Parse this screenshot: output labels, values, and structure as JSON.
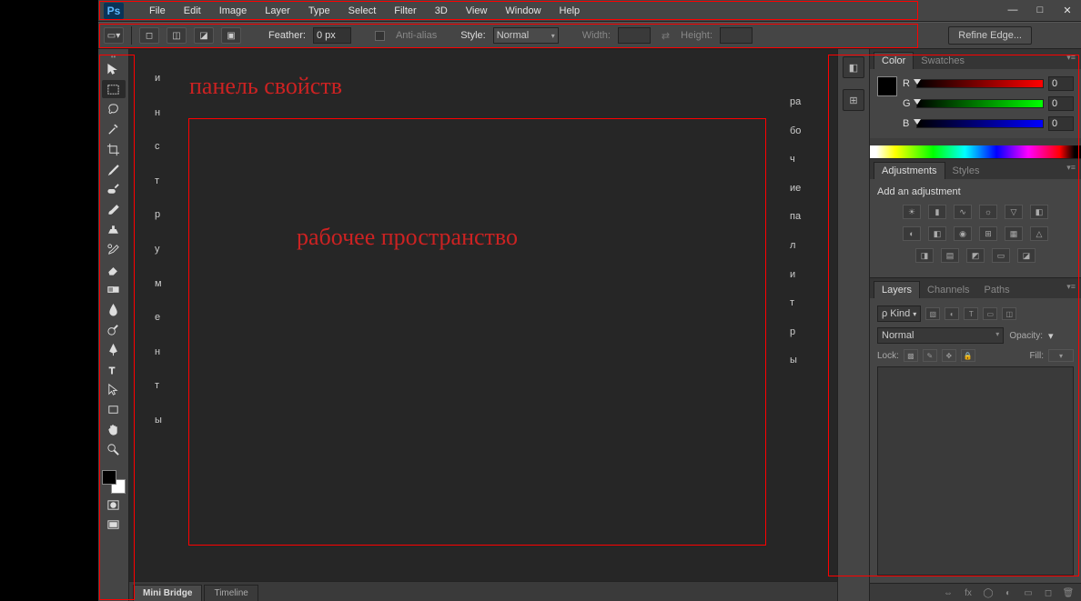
{
  "menu": {
    "items": [
      "File",
      "Edit",
      "Image",
      "Layer",
      "Type",
      "Select",
      "Filter",
      "3D",
      "View",
      "Window",
      "Help"
    ]
  },
  "logo": "Ps",
  "window_controls": {
    "min": "—",
    "max": "□",
    "close": "✕"
  },
  "options": {
    "feather": {
      "label": "Feather:",
      "value": "0 px"
    },
    "antialias": "Anti-alias",
    "style": {
      "label": "Style:",
      "value": "Normal"
    },
    "width": {
      "label": "Width:",
      "value": ""
    },
    "height": {
      "label": "Height:",
      "value": ""
    },
    "refine": "Refine Edge..."
  },
  "bottom_tabs": [
    "Mini Bridge",
    "Timeline"
  ],
  "panels": {
    "color": {
      "tab1": "Color",
      "tab2": "Swatches",
      "r": "R",
      "g": "G",
      "b": "B",
      "rv": "0",
      "gv": "0",
      "bv": "0"
    },
    "adjustments": {
      "tab1": "Adjustments",
      "tab2": "Styles",
      "label": "Add an adjustment"
    },
    "layers": {
      "tab1": "Layers",
      "tab2": "Channels",
      "tab3": "Paths",
      "kind": "Kind",
      "blend": "Normal",
      "opacity": "Opacity:",
      "lock": "Lock:",
      "fill": "Fill:"
    }
  },
  "annotations": {
    "top": "панель свойств",
    "workspace": "рабочее пространство",
    "left_letters": [
      "и",
      "н",
      "с",
      "т",
      "р",
      "у",
      "м",
      "е",
      "н",
      "т",
      "ы"
    ],
    "right_letters": [
      "ра",
      "бо",
      "ч",
      "ие",
      "па",
      "л",
      "и",
      "т",
      "р",
      "ы"
    ]
  }
}
